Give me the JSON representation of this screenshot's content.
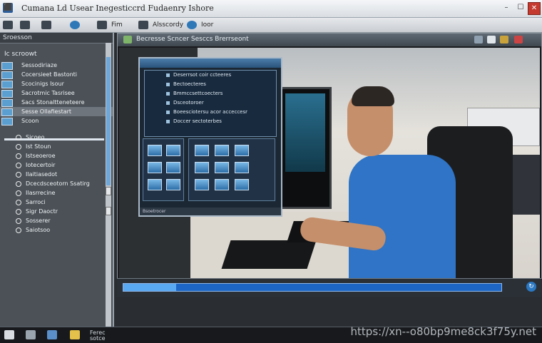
{
  "window": {
    "title": "Cumana Ld Usear Inegesticcrd Fudaenry Ishore",
    "app_icon_glyph": "⬛",
    "close_glyph": "✕"
  },
  "toolbar": {
    "items": [
      {
        "label": "",
        "icon": "back-arrow-icon"
      },
      {
        "label": "",
        "icon": "folder-icon"
      },
      {
        "label": "",
        "icon": "search-icon"
      },
      {
        "label": "",
        "icon": "globe-icon"
      },
      {
        "label": "Fim",
        "icon": "document-icon"
      },
      {
        "label": "Alsscordy",
        "icon": "user-icon"
      },
      {
        "label": "Ioor",
        "icon": "settings-icon"
      }
    ]
  },
  "sidebar": {
    "header": "Sroesson",
    "root_label": "Ic scroowt",
    "items": [
      {
        "label": "Sessodiriaze"
      },
      {
        "label": "Cocersieet Bastonti"
      },
      {
        "label": "Scocinigs Isour"
      },
      {
        "label": "Sacrotmic Tasrisee"
      },
      {
        "label": "Sacs Stonaltteneteere"
      },
      {
        "label": "Sesse Ollafiestart"
      },
      {
        "label": "Scoon"
      }
    ],
    "subitems": [
      {
        "label": "Sicoeo"
      },
      {
        "label": "Ist Stoun"
      },
      {
        "label": "Istseoeroe"
      },
      {
        "label": "Iotecertoir"
      },
      {
        "label": "Ilaitiasedot"
      },
      {
        "label": "Dcecdsceotorn Ssatirg"
      },
      {
        "label": "Ilasrrecine"
      },
      {
        "label": "Sarroci"
      },
      {
        "label": "Sigr Daoctr"
      },
      {
        "label": "Sosserer"
      },
      {
        "label": "Saiotsoo"
      }
    ]
  },
  "video": {
    "title": "Becresse Scncer Sesccs Brerrseont"
  },
  "dialog": {
    "rows": [
      "Deserrsot coir ccteeres",
      "Bectoecteres",
      "Bmmccsettcoecters",
      "Dsceotoroer",
      "Boeesciotersu acor acceccesr",
      "Doccer sectoterbes"
    ],
    "status": "Bsoetrocer"
  },
  "seek": {
    "progress": 0.14,
    "end_icon": "↻"
  },
  "taskbar": {
    "items": [
      {
        "icon": "start-icon"
      },
      {
        "icon": "window-icon"
      },
      {
        "icon": "monitor-icon"
      },
      {
        "icon": "star-icon"
      }
    ],
    "texts": [
      "Ferec",
      "sotce"
    ]
  },
  "watermark": "https://xn--o80bp9me8ck3f75y.net"
}
